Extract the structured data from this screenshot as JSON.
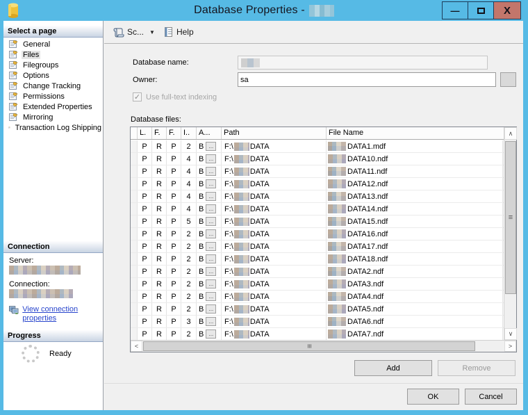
{
  "window": {
    "title": "Database Properties -",
    "controls": {
      "minimize": "—",
      "close": "X"
    }
  },
  "sidebar": {
    "select_page_header": "Select a page",
    "pages": [
      {
        "label": "General",
        "selected": false
      },
      {
        "label": "Files",
        "selected": true
      },
      {
        "label": "Filegroups",
        "selected": false
      },
      {
        "label": "Options",
        "selected": false
      },
      {
        "label": "Change Tracking",
        "selected": false
      },
      {
        "label": "Permissions",
        "selected": false
      },
      {
        "label": "Extended Properties",
        "selected": false
      },
      {
        "label": "Mirroring",
        "selected": false
      },
      {
        "label": "Transaction Log Shipping",
        "selected": false
      }
    ],
    "connection": {
      "header": "Connection",
      "server_label": "Server:",
      "connection_label": "Connection:",
      "link": "View connection properties"
    },
    "progress": {
      "header": "Progress",
      "status": "Ready"
    }
  },
  "toolbar": {
    "script": "Sc...",
    "caret": "▼",
    "help": "Help"
  },
  "form": {
    "database_name_label": "Database name:",
    "owner_label": "Owner:",
    "owner_value": "sa",
    "checkbox_glyph": "✓",
    "fulltext_label": "Use full-text indexing",
    "files_label": "Database files:"
  },
  "table": {
    "columns": [
      "L.",
      "F.",
      "F.",
      "I..",
      "A...",
      "Path",
      "File Name"
    ],
    "rows": [
      {
        "l": "P",
        "f1": "R",
        "f2": "P",
        "size": "2",
        "a": "B",
        "browse": "...",
        "path_drive": "F:\\",
        "path_tail": "DATA",
        "file": "DATA1.mdf"
      },
      {
        "l": "P",
        "f1": "R",
        "f2": "P",
        "size": "4",
        "a": "B",
        "browse": "...",
        "path_drive": "F:\\",
        "path_tail": "DATA",
        "file": "DATA10.ndf"
      },
      {
        "l": "P",
        "f1": "R",
        "f2": "P",
        "size": "4",
        "a": "B",
        "browse": "...",
        "path_drive": "F:\\",
        "path_tail": "DATA",
        "file": "DATA11.ndf"
      },
      {
        "l": "P",
        "f1": "R",
        "f2": "P",
        "size": "4",
        "a": "B",
        "browse": "...",
        "path_drive": "F:\\",
        "path_tail": "DATA",
        "file": "DATA12.ndf"
      },
      {
        "l": "P",
        "f1": "R",
        "f2": "P",
        "size": "4",
        "a": "B",
        "browse": "...",
        "path_drive": "F:\\",
        "path_tail": "DATA",
        "file": "DATA13.ndf"
      },
      {
        "l": "P",
        "f1": "R",
        "f2": "P",
        "size": "4",
        "a": "B",
        "browse": "...",
        "path_drive": "F:\\",
        "path_tail": "DATA",
        "file": "DATA14.ndf"
      },
      {
        "l": "P",
        "f1": "R",
        "f2": "P",
        "size": "5",
        "a": "B",
        "browse": "...",
        "path_drive": "F:\\",
        "path_tail": "DATA",
        "file": "DATA15.ndf"
      },
      {
        "l": "P",
        "f1": "R",
        "f2": "P",
        "size": "2",
        "a": "B",
        "browse": "...",
        "path_drive": "F:\\",
        "path_tail": "DATA",
        "file": "DATA16.ndf"
      },
      {
        "l": "P",
        "f1": "R",
        "f2": "P",
        "size": "2",
        "a": "B",
        "browse": "...",
        "path_drive": "F:\\",
        "path_tail": "DATA",
        "file": "DATA17.ndf"
      },
      {
        "l": "P",
        "f1": "R",
        "f2": "P",
        "size": "2",
        "a": "B",
        "browse": "...",
        "path_drive": "F:\\",
        "path_tail": "DATA",
        "file": "DATA18.ndf"
      },
      {
        "l": "P",
        "f1": "R",
        "f2": "P",
        "size": "2",
        "a": "B",
        "browse": "...",
        "path_drive": "F:\\",
        "path_tail": "DATA",
        "file": "DATA2.ndf"
      },
      {
        "l": "P",
        "f1": "R",
        "f2": "P",
        "size": "2",
        "a": "B",
        "browse": "...",
        "path_drive": "F:\\",
        "path_tail": "DATA",
        "file": "DATA3.ndf"
      },
      {
        "l": "P",
        "f1": "R",
        "f2": "P",
        "size": "2",
        "a": "B",
        "browse": "...",
        "path_drive": "F:\\",
        "path_tail": "DATA",
        "file": "DATA4.ndf"
      },
      {
        "l": "P",
        "f1": "R",
        "f2": "P",
        "size": "2",
        "a": "B",
        "browse": "...",
        "path_drive": "F:\\",
        "path_tail": "DATA",
        "file": "DATA5.ndf"
      },
      {
        "l": "P",
        "f1": "R",
        "f2": "P",
        "size": "3",
        "a": "B",
        "browse": "...",
        "path_drive": "F:\\",
        "path_tail": "DATA",
        "file": "DATA6.ndf"
      },
      {
        "l": "P",
        "f1": "R",
        "f2": "P",
        "size": "2",
        "a": "B",
        "browse": "...",
        "path_drive": "F:\\",
        "path_tail": "DATA",
        "file": "DATA7.ndf"
      }
    ]
  },
  "actions": {
    "add": "Add",
    "remove": "Remove",
    "ok": "OK",
    "cancel": "Cancel"
  },
  "ui": {
    "scroll_up": "∧",
    "scroll_down": "∨",
    "scroll_left": "<",
    "scroll_right": ">",
    "grip": "≡"
  },
  "colors": {
    "titlebar": "#56bae5",
    "close_button": "#c3766b",
    "link": "#2744cc",
    "header_gradient_bottom": "#c9d4e3"
  }
}
